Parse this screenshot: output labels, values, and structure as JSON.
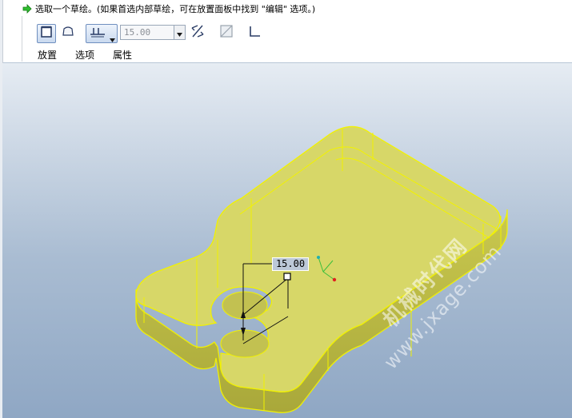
{
  "prompt": {
    "text": "选取一个草绘。(如果首选内部草绘，可在放置面板中找到 \"编辑\" 选项。)",
    "icon": "green-arrow-icon"
  },
  "toolbar": {
    "depth_value": "15.00",
    "tabs": [
      "放置",
      "选项",
      "属性"
    ]
  },
  "viewport": {
    "dimension_value": "15.00",
    "watermark_cn": "机械时代网",
    "watermark_url": "www.jxage.com"
  },
  "colors": {
    "part_fill": "#d7d768",
    "part_edge": "#f2f200",
    "toolbar_accent": "#6f8fbf"
  }
}
